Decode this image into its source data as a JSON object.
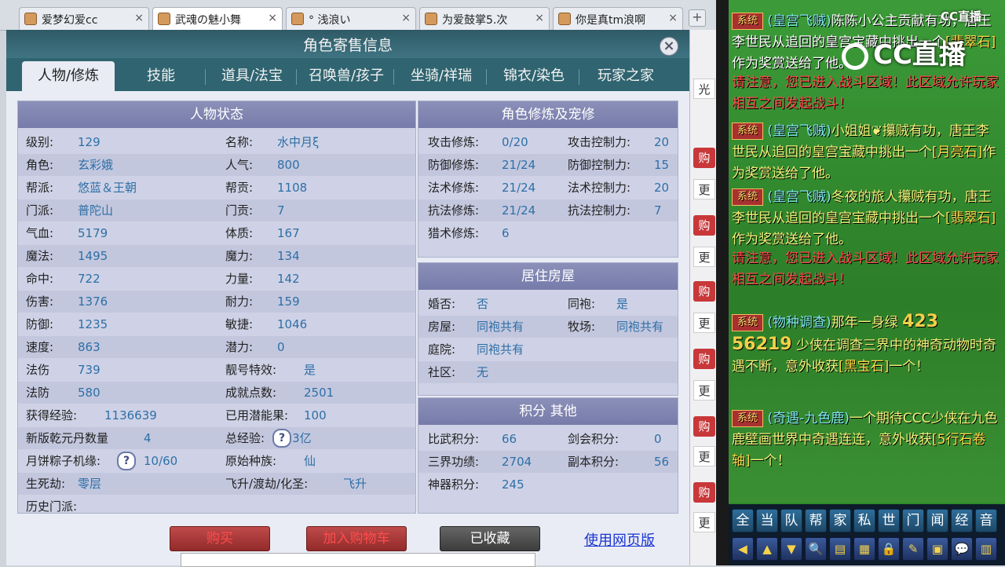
{
  "browser": {
    "tabs": [
      {
        "title": "爱梦幻爱cc",
        "close": "×"
      },
      {
        "title": "武魂の魅小舞",
        "close": "×"
      },
      {
        "title": "° 浅浪い",
        "close": "×"
      },
      {
        "title": "为爱鼓掌5.次",
        "close": "×"
      },
      {
        "title": "你是真tm浪啊",
        "close": "×"
      }
    ],
    "new_tab": "+"
  },
  "window": {
    "title": "角色寄售信息",
    "close": "×",
    "tabs": [
      "人物/修炼",
      "技能",
      "道具/法宝",
      "召唤兽/孩子",
      "坐骑/祥瑞",
      "锦衣/染色",
      "玩家之家"
    ]
  },
  "status": {
    "header": "人物状态",
    "left": [
      {
        "label": "级别:",
        "value": "129"
      },
      {
        "label": "角色:",
        "value": "玄彩娥"
      },
      {
        "label": "帮派:",
        "value": "悠蓝＆王朝"
      },
      {
        "label": "门派:",
        "value": "普陀山"
      },
      {
        "label": "气血:",
        "value": "5179"
      },
      {
        "label": "魔法:",
        "value": "1495"
      },
      {
        "label": "命中:",
        "value": "722"
      },
      {
        "label": "伤害:",
        "value": "1376"
      },
      {
        "label": "防御:",
        "value": "1235"
      },
      {
        "label": "速度:",
        "value": "863"
      },
      {
        "label": "法伤",
        "value": "739"
      },
      {
        "label": "法防",
        "value": "580"
      },
      {
        "label": "获得经验:",
        "value": "1136639"
      },
      {
        "label": "新版乾元丹数量",
        "value": "4"
      },
      {
        "label": "月饼粽子机缘:",
        "value": "10/60"
      },
      {
        "label": "生死劫:",
        "value": "零层"
      },
      {
        "label": "历史门派:",
        "value": ""
      }
    ],
    "right": [
      {
        "label": "名称:",
        "value": "水中月ξ"
      },
      {
        "label": "人气:",
        "value": "800"
      },
      {
        "label": "帮贡:",
        "value": "1108"
      },
      {
        "label": "门贡:",
        "value": "7"
      },
      {
        "label": "体质:",
        "value": "167"
      },
      {
        "label": "魔力:",
        "value": "134"
      },
      {
        "label": "力量:",
        "value": "142"
      },
      {
        "label": "耐力:",
        "value": "159"
      },
      {
        "label": "敏捷:",
        "value": "1046"
      },
      {
        "label": "潜力:",
        "value": "0"
      },
      {
        "label": "靓号特效:",
        "value": "是"
      },
      {
        "label": "成就点数:",
        "value": "2501"
      },
      {
        "label": "已用潜能果:",
        "value": "100"
      },
      {
        "label": "总经验:",
        "value": "123亿"
      },
      {
        "label": "原始种族:",
        "value": "仙"
      },
      {
        "label": "飞升/渡劫/化圣:",
        "value": "飞升"
      }
    ],
    "help": "?"
  },
  "cultivation": {
    "header": "角色修炼及宠修",
    "rows": [
      {
        "l1": "攻击修炼:",
        "v1": "0/20",
        "l2": "攻击控制力:",
        "v2": "20"
      },
      {
        "l1": "防御修炼:",
        "v1": "21/24",
        "l2": "防御控制力:",
        "v2": "15"
      },
      {
        "l1": "法术修炼:",
        "v1": "21/24",
        "l2": "法术控制力:",
        "v2": "20"
      },
      {
        "l1": "抗法修炼:",
        "v1": "21/24",
        "l2": "抗法控制力:",
        "v2": "7"
      },
      {
        "l1": "猎术修炼:",
        "v1": "6",
        "l2": "",
        "v2": ""
      }
    ]
  },
  "housing": {
    "header": "居住房屋",
    "rows": [
      {
        "l1": "婚否:",
        "v1": "否",
        "l2": "同袍:",
        "v2": "是"
      },
      {
        "l1": "房屋:",
        "v1": "同袍共有",
        "l2": "牧场:",
        "v2": "同袍共有"
      },
      {
        "l1": "庭院:",
        "v1": "同袍共有",
        "l2": "",
        "v2": ""
      },
      {
        "l1": "社区:",
        "v1": "无",
        "l2": "",
        "v2": ""
      }
    ]
  },
  "points": {
    "header": "积分 其他",
    "rows": [
      {
        "l1": "比武积分:",
        "v1": "66",
        "l2": "剑会积分:",
        "v2": "0"
      },
      {
        "l1": "三界功绩:",
        "v1": "2704",
        "l2": "副本积分:",
        "v2": "56"
      },
      {
        "l1": "神器积分:",
        "v1": "245",
        "l2": "",
        "v2": ""
      }
    ]
  },
  "actions": {
    "buy": "购买",
    "add_cart": "加入购物车",
    "favorited": "已收藏",
    "web_version": "使用网页版"
  },
  "side_buttons": [
    "光",
    "购",
    "更",
    "购",
    "更",
    "购",
    "更",
    "购",
    "更",
    "购",
    "更",
    "购",
    "更"
  ],
  "chat": {
    "brand": "CC直播",
    "brand_small": "CC直播",
    "sys_tag": "系统",
    "messages": [
      {
        "from": "(皇宫飞贼)",
        "text": "陈陈小公主贡献有功，唐王李世民从追回的皇宫宝藏中挑出一个",
        "item": "[翡翠石]",
        "tail": "作为奖赏送给了他。"
      },
      {
        "warn": "请注意，您已进入战斗区域！此区域允许玩家相互之间发起战斗！"
      },
      {
        "from": "(皇宫飞贼)",
        "text": "小姐姐❦攥贼有功，唐王李世民从追回的皇宫宝藏中挑出一个",
        "item": "[月亮石]",
        "tail": "作为奖赏送给了他。"
      },
      {
        "from": "(皇宫飞贼)",
        "text": "冬夜的旅人攥贼有功，唐王李世民从追回的皇宫宝藏中挑出一个",
        "item": "[翡翠石]",
        "tail": "作为奖赏送给了他。"
      },
      {
        "warn": "请注意，您已进入战斗区域！此区域允许玩家相互之间发起战斗！"
      },
      {
        "from": "(物种调查)",
        "text": "那年一身绿",
        "num1": "423",
        "num2": "56219",
        "text2": "少侠在调查三界中的神奇动物时奇遇不断，意外收获",
        "item": "[黑宝石]",
        "tail": "一个！"
      },
      {
        "from": "(奇遇-九色鹿)",
        "text": "一个期待CCC少侠在九色鹿壁画世界中奇遇连连，意外收获",
        "item": "[5行石卷轴]",
        "tail": "一个！"
      }
    ],
    "toolbar1": [
      "全",
      "当",
      "队",
      "帮",
      "家",
      "私",
      "世",
      "门",
      "闻",
      "经",
      "音"
    ],
    "toolbar2": [
      "◀",
      "▲",
      "▼",
      "🔍",
      "▤",
      "▦",
      "🔒",
      "✎",
      "▣",
      "💬",
      "▥"
    ]
  }
}
